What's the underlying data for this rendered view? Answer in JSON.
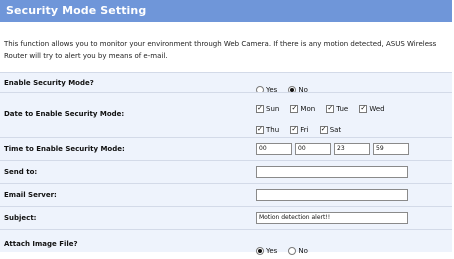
{
  "header": {
    "title": "Security Mode Setting"
  },
  "description": "This function allows you to monitor your environment through Web Camera. If there is any motion detected, ASUS Wireless Router will try to alert you by means of e-mail.",
  "fields": {
    "enable_security": {
      "label": "Enable Security Mode?",
      "options": [
        "Yes",
        "No"
      ],
      "selected": "No"
    },
    "date": {
      "label": "Date to Enable Security Mode:",
      "days_row1": [
        "Sun",
        "Mon",
        "Tue",
        "Wed"
      ],
      "days_row2": [
        "Thu",
        "Fri",
        "Sat"
      ],
      "checked": [
        "Sun",
        "Mon",
        "Tue",
        "Wed",
        "Thu",
        "Fri",
        "Sat"
      ]
    },
    "time": {
      "label": "Time to Enable Security Mode:",
      "values": [
        "00",
        "00",
        "23",
        "59"
      ]
    },
    "send_to": {
      "label": "Send to:",
      "value": ""
    },
    "email_server": {
      "label": "Email Server:",
      "value": ""
    },
    "subject": {
      "label": "Subject:",
      "value": "Motion detection alert!!"
    },
    "attach_image": {
      "label": "Attach Image File?",
      "options": [
        "Yes",
        "No"
      ],
      "selected": "Yes"
    }
  }
}
